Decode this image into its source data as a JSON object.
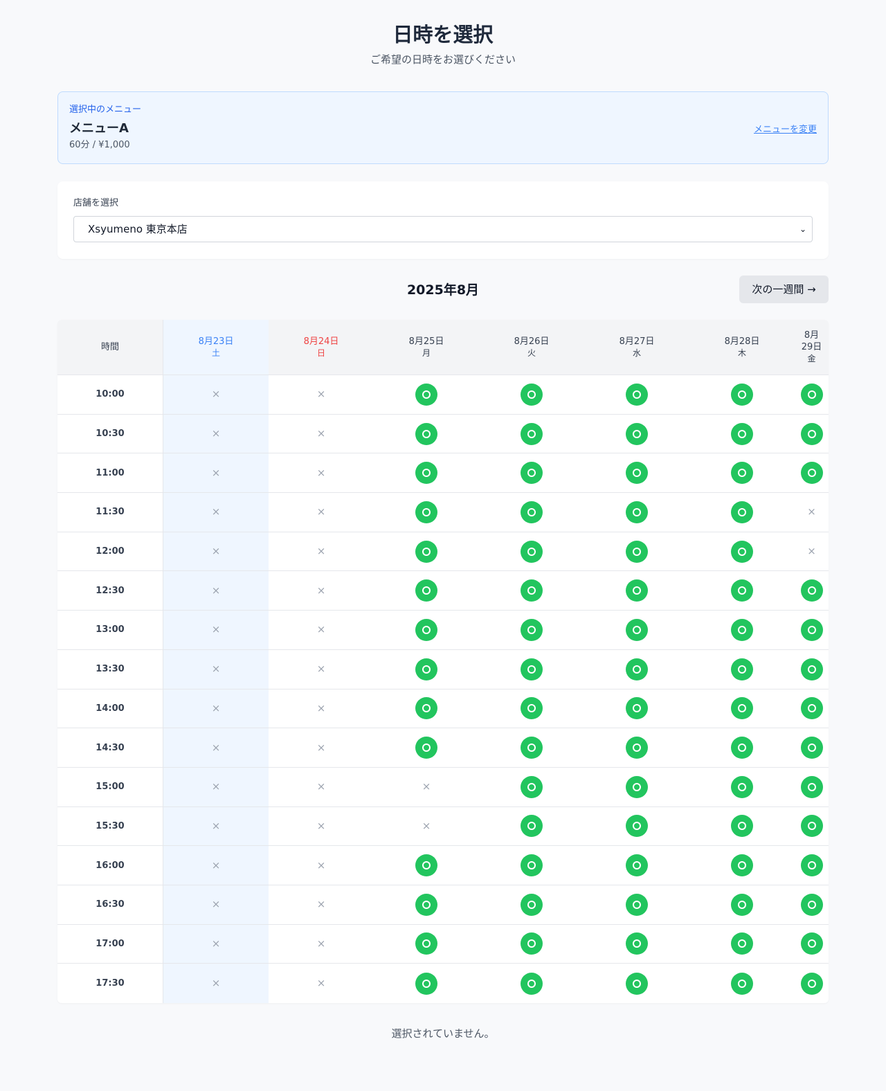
{
  "page": {
    "title": "日時を選択",
    "subtitle": "ご希望の日時をお選びください"
  },
  "menu": {
    "caption": "選択中のメニュー",
    "name": "メニューA",
    "detail": "60分 / ¥1,000",
    "change_label": "メニューを変更"
  },
  "store": {
    "label": "店舗を選択",
    "selected": "Xsyumeno 東京本店"
  },
  "calendar": {
    "month": "2025年8月",
    "next_week_label": "次の一週間 →",
    "time_header": "時間",
    "days": [
      {
        "date": "8月23日",
        "weekday": "土",
        "state": "selected"
      },
      {
        "date": "8月24日",
        "weekday": "日",
        "state": "sunday"
      },
      {
        "date": "8月25日",
        "weekday": "月",
        "state": "normal"
      },
      {
        "date": "8月26日",
        "weekday": "火",
        "state": "normal"
      },
      {
        "date": "8月27日",
        "weekday": "水",
        "state": "normal"
      },
      {
        "date": "8月28日",
        "weekday": "木",
        "state": "normal"
      },
      {
        "date": "8月29日",
        "weekday": "金",
        "state": "normal"
      }
    ],
    "last_day_header_lines": [
      "8月",
      "29日",
      "金"
    ],
    "available_symbol": "○",
    "unavailable_symbol": "×",
    "slots": [
      {
        "time": "10:00",
        "avail": [
          0,
          0,
          1,
          1,
          1,
          1,
          1
        ]
      },
      {
        "time": "10:30",
        "avail": [
          0,
          0,
          1,
          1,
          1,
          1,
          1
        ]
      },
      {
        "time": "11:00",
        "avail": [
          0,
          0,
          1,
          1,
          1,
          1,
          1
        ]
      },
      {
        "time": "11:30",
        "avail": [
          0,
          0,
          1,
          1,
          1,
          1,
          0
        ]
      },
      {
        "time": "12:00",
        "avail": [
          0,
          0,
          1,
          1,
          1,
          1,
          0
        ]
      },
      {
        "time": "12:30",
        "avail": [
          0,
          0,
          1,
          1,
          1,
          1,
          1
        ]
      },
      {
        "time": "13:00",
        "avail": [
          0,
          0,
          1,
          1,
          1,
          1,
          1
        ]
      },
      {
        "time": "13:30",
        "avail": [
          0,
          0,
          1,
          1,
          1,
          1,
          1
        ]
      },
      {
        "time": "14:00",
        "avail": [
          0,
          0,
          1,
          1,
          1,
          1,
          1
        ]
      },
      {
        "time": "14:30",
        "avail": [
          0,
          0,
          1,
          1,
          1,
          1,
          1
        ]
      },
      {
        "time": "15:00",
        "avail": [
          0,
          0,
          0,
          1,
          1,
          1,
          1
        ]
      },
      {
        "time": "15:30",
        "avail": [
          0,
          0,
          0,
          1,
          1,
          1,
          1
        ]
      },
      {
        "time": "16:00",
        "avail": [
          0,
          0,
          1,
          1,
          1,
          1,
          1
        ]
      },
      {
        "time": "16:30",
        "avail": [
          0,
          0,
          1,
          1,
          1,
          1,
          1
        ]
      },
      {
        "time": "17:00",
        "avail": [
          0,
          0,
          1,
          1,
          1,
          1,
          1
        ]
      },
      {
        "time": "17:30",
        "avail": [
          0,
          0,
          1,
          1,
          1,
          1,
          1
        ]
      }
    ]
  },
  "status_text": "選択されていません。",
  "colors": {
    "available": "#22c55e",
    "selected_column_bg": "#eff6ff",
    "selected_day_text": "#3b82f6",
    "sunday_text": "#ef4444",
    "unavailable": "#9ca3af"
  }
}
